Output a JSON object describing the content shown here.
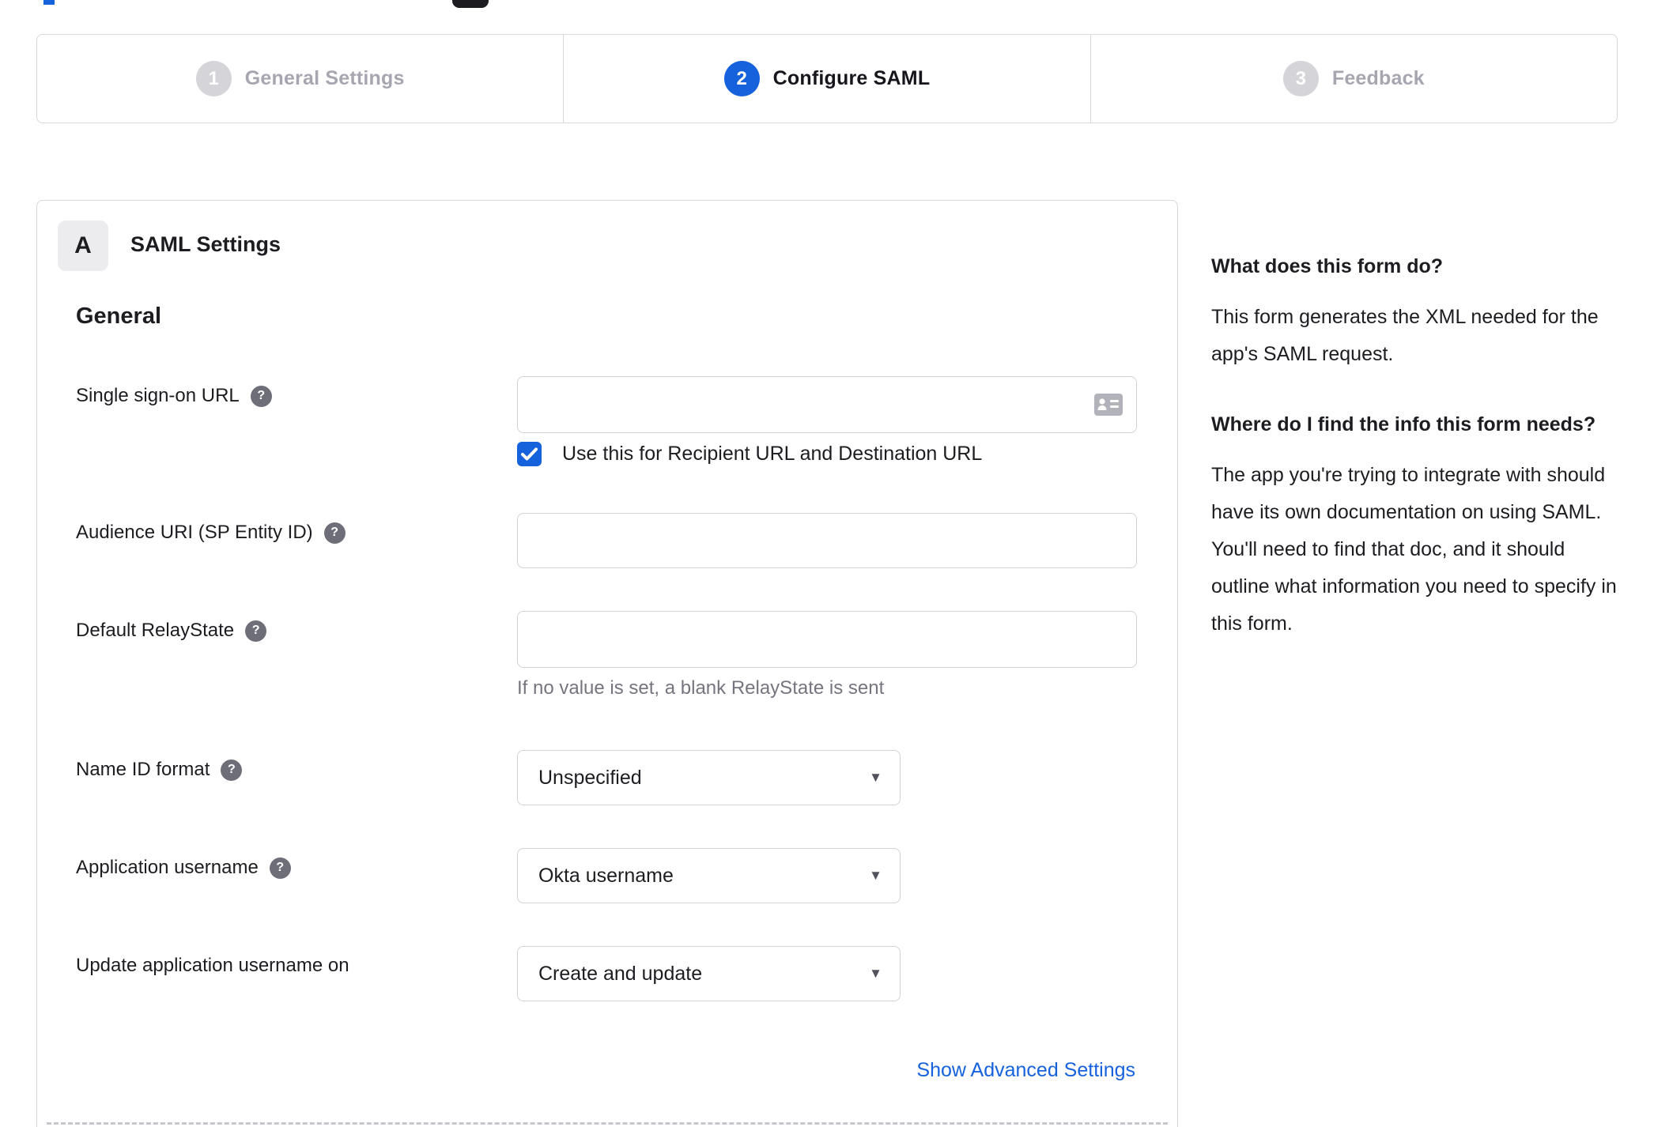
{
  "colors": {
    "accent": "#1662dd",
    "inactive_gray": "#d4d4d9",
    "border": "#d7d7dc"
  },
  "stepper": {
    "steps": [
      {
        "number": "1",
        "label": "General Settings",
        "state": "inactive"
      },
      {
        "number": "2",
        "label": "Configure SAML",
        "state": "active"
      },
      {
        "number": "3",
        "label": "Feedback",
        "state": "inactive"
      }
    ]
  },
  "panel": {
    "badge": "A",
    "title": "SAML Settings",
    "section_heading": "General",
    "fields": {
      "sso": {
        "label": "Single sign-on URL",
        "value": "",
        "checkbox_checked": true,
        "checkbox_label": "Use this for Recipient URL and Destination URL"
      },
      "audience": {
        "label": "Audience URI (SP Entity ID)",
        "value": ""
      },
      "relay": {
        "label": "Default RelayState",
        "value": "",
        "hint": "If no value is set, a blank RelayState is sent"
      },
      "nameid": {
        "label": "Name ID format",
        "value": "Unspecified"
      },
      "appuser": {
        "label": "Application username",
        "value": "Okta username"
      },
      "update": {
        "label": "Update application username on",
        "value": "Create and update"
      }
    },
    "advanced_link": "Show Advanced Settings"
  },
  "help_sidebar": {
    "q1": "What does this form do?",
    "a1": "This form generates the XML needed for the app's SAML request.",
    "q2": "Where do I find the info this form needs?",
    "a2": "The app you're trying to integrate with should have its own documentation on using SAML. You'll need to find that doc, and it should outline what information you need to specify in this form."
  }
}
